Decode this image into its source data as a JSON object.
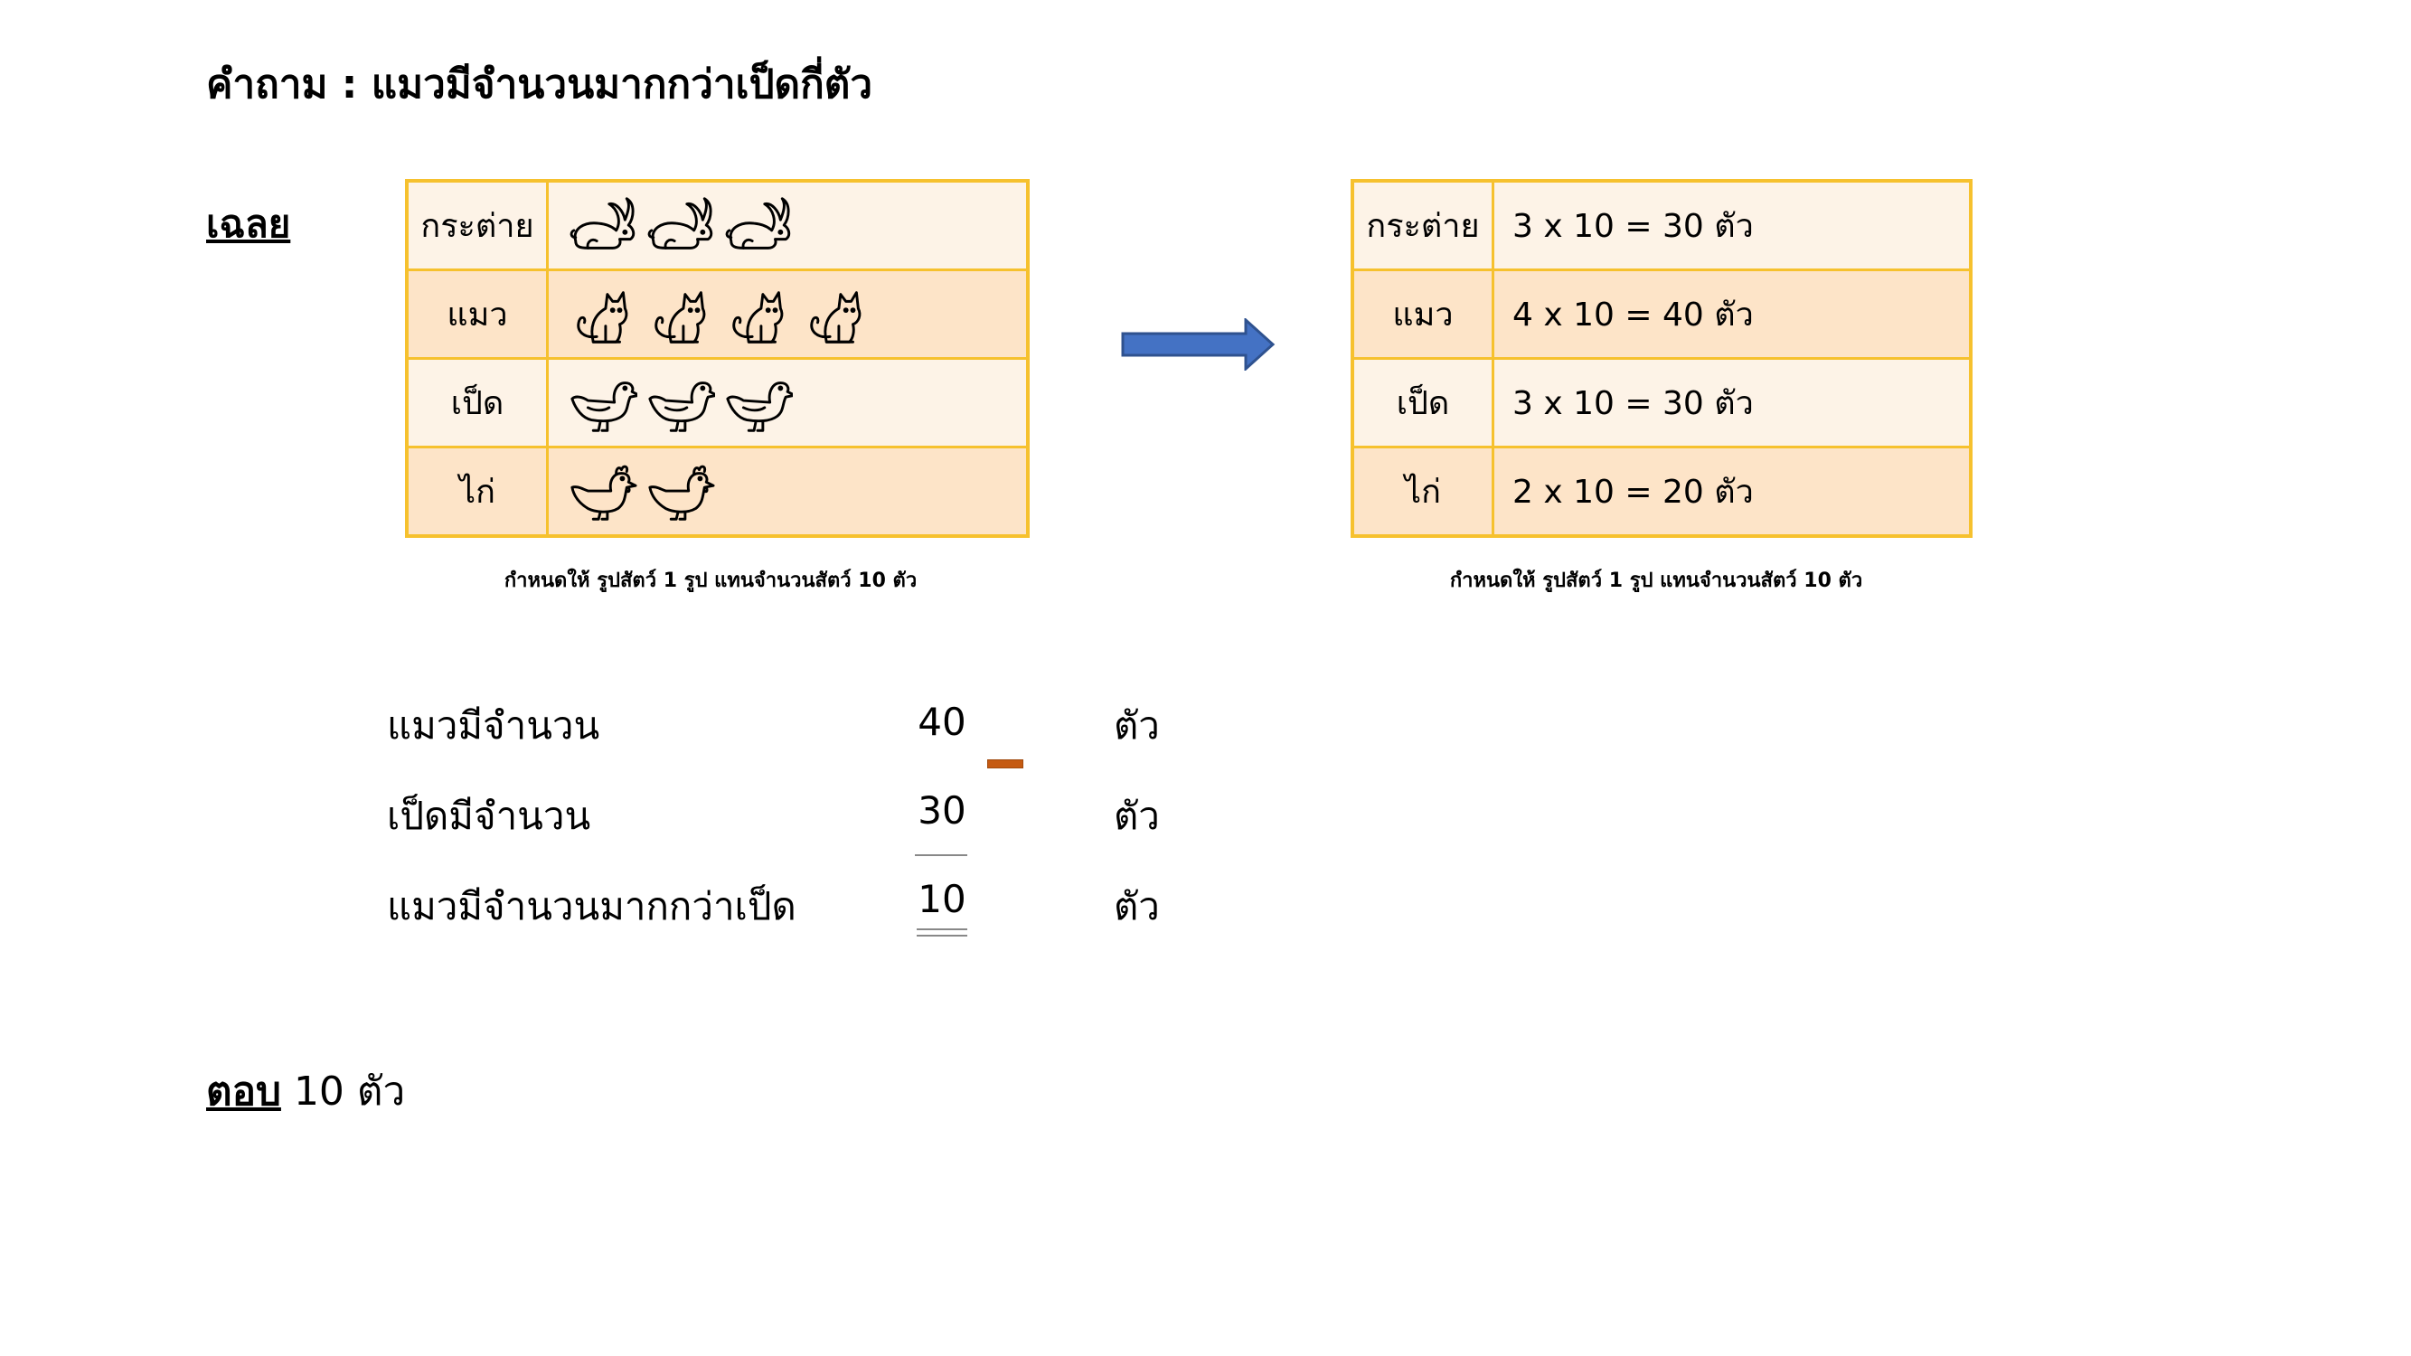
{
  "question": "คำถาม :  แมวมีจำนวนมากกว่าเป็ดกี่ตัว",
  "answer_heading": "เฉลย",
  "pictograph": {
    "rows": [
      {
        "label": "กระต่าย",
        "icon": "rabbit-icon",
        "count": 3
      },
      {
        "label": "แมว",
        "icon": "cat-icon",
        "count": 4
      },
      {
        "label": "เป็ด",
        "icon": "duck-icon",
        "count": 3
      },
      {
        "label": "ไก่",
        "icon": "chicken-icon",
        "count": 2
      }
    ],
    "caption": "กำหนดให้ รูปสัตว์ 1 รูป แทนจำนวนสัตว์ 10 ตัว"
  },
  "arrow": {
    "icon": "right-arrow-icon",
    "color": "#4472c4"
  },
  "equation_table": {
    "rows": [
      {
        "label": "กระต่าย",
        "equation": "3 x 10 = 30 ตัว"
      },
      {
        "label": "แมว",
        "equation": "4 x 10 = 40 ตัว"
      },
      {
        "label": "เป็ด",
        "equation": "3 x 10 = 30 ตัว"
      },
      {
        "label": "ไก่",
        "equation": "2 x 10 = 20 ตัว"
      }
    ],
    "caption": "กำหนดให้ รูปสัตว์ 1 รูป แทนจำนวนสัตว์ 10 ตัว"
  },
  "calculation": {
    "rows": [
      {
        "label": "แมวมีจำนวน",
        "value": "40",
        "unit": "ตัว"
      },
      {
        "label": "เป็ดมีจำนวน",
        "value": "30",
        "unit": "ตัว"
      },
      {
        "label": "แมวมีจำนวนมากกว่าเป็ด",
        "value": "10",
        "unit": "ตัว"
      }
    ],
    "operator_color": "#c55a11"
  },
  "final_answer": {
    "label": "ตอบ",
    "value": "10 ตัว"
  },
  "colors": {
    "table_border": "#f6c12e",
    "row_light": "#fdf3e7",
    "row_dark": "#fde4c8"
  }
}
